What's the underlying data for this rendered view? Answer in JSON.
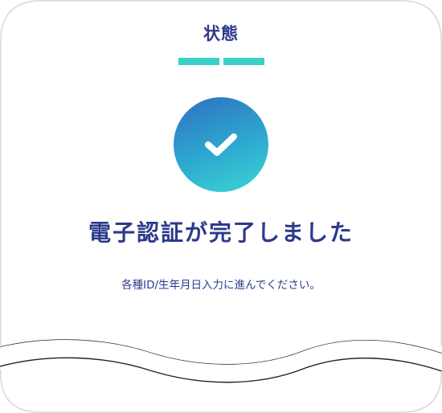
{
  "status": {
    "title": "状態",
    "steps_total": 2,
    "steps_completed": 2,
    "accent_color": "#3ad0c6",
    "text_color": "#2c3a8c",
    "icon": "checkmark-icon",
    "headline": "電子認証が完了しました",
    "message": "各種ID/生年月日入力に進んでください。"
  }
}
